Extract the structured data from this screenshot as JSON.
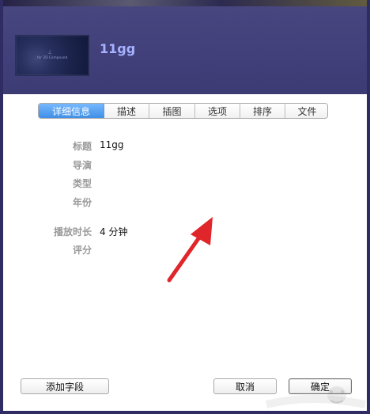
{
  "header": {
    "title": "11gg",
    "thumbnail_caption": "for 2D Compound",
    "thumbnail_mark": "⊥"
  },
  "tabs": {
    "items": [
      {
        "label": "详细信息",
        "active": true
      },
      {
        "label": "描述",
        "active": false
      },
      {
        "label": "插图",
        "active": false
      },
      {
        "label": "选项",
        "active": false
      },
      {
        "label": "排序",
        "active": false
      },
      {
        "label": "文件",
        "active": false
      }
    ]
  },
  "details": {
    "title_label": "标题",
    "title_value": "11gg",
    "director_label": "导演",
    "genre_label": "类型",
    "year_label": "年份",
    "duration_label": "播放时长",
    "duration_value": "4 分钟",
    "rating_label": "评分"
  },
  "footer": {
    "add_field_label": "添加字段",
    "cancel_label": "取消",
    "ok_label": "确定"
  },
  "annotation": {
    "arrow_color": "#e0262b",
    "watermark_icon": "baidu-jingyan-icon"
  }
}
